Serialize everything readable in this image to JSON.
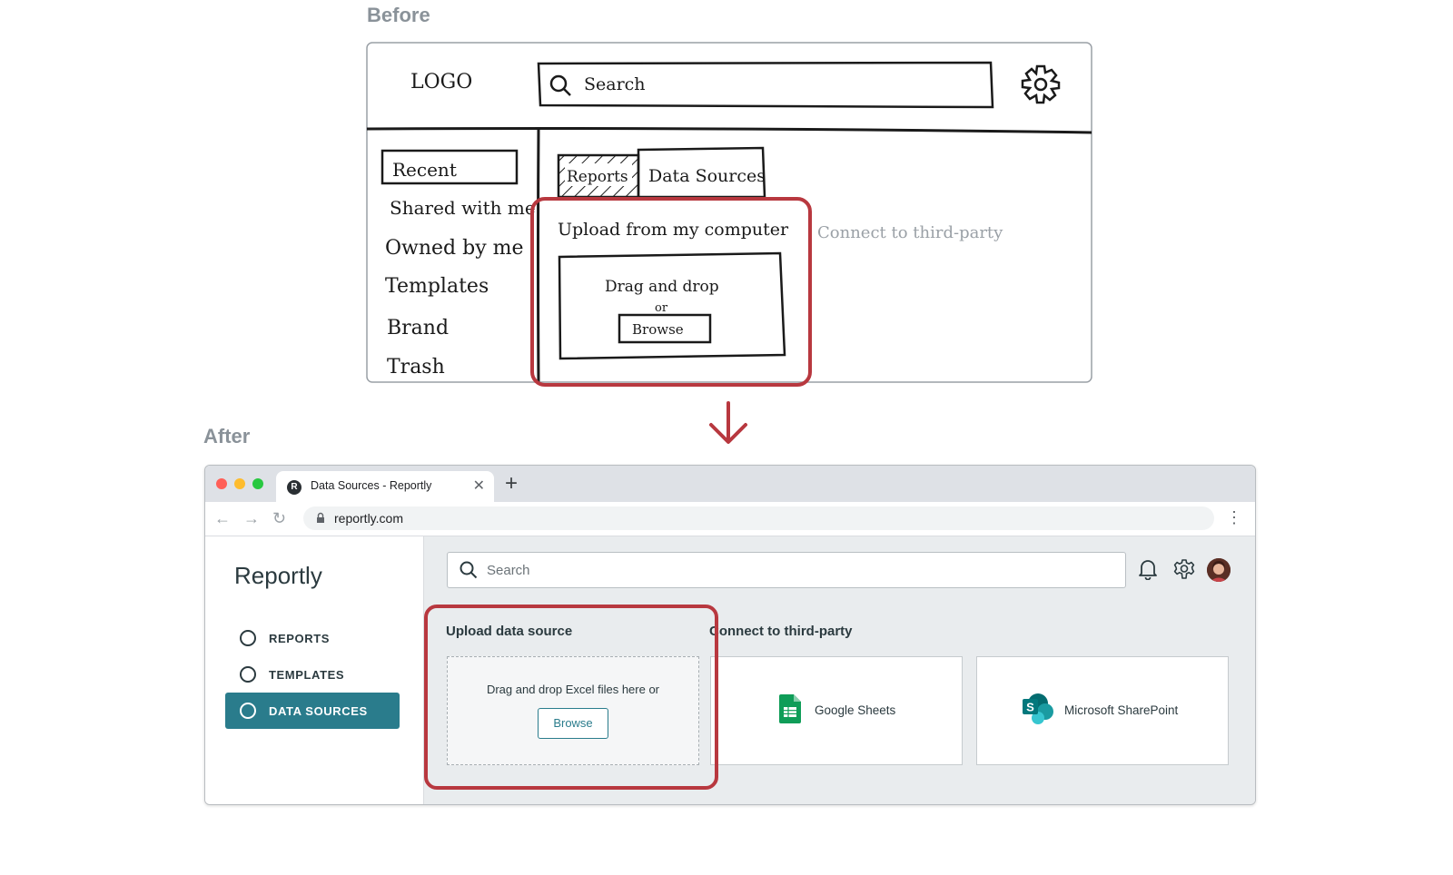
{
  "before": {
    "label": "Before",
    "logo": "LOGO",
    "search": "Search",
    "sidebar": [
      "Recent",
      "Shared with me",
      "Owned by me",
      "Templates",
      "Brand",
      "Trash"
    ],
    "tabs": [
      "Reports",
      "Data Sources"
    ],
    "upload_title": "Upload from my computer",
    "drag_text": "Drag and drop",
    "or_text": "or",
    "browse": "Browse",
    "connect": "Connect to third-party"
  },
  "after": {
    "label": "After",
    "browser": {
      "tab_title": "Data Sources - Reportly",
      "favicon": "R",
      "url": "reportly.com"
    },
    "app": {
      "brand": "Reportly",
      "nav": [
        {
          "label": "REPORTS",
          "active": false
        },
        {
          "label": "TEMPLATES",
          "active": false
        },
        {
          "label": "DATA SOURCES",
          "active": true
        }
      ],
      "search_placeholder": "Search",
      "upload": {
        "title": "Upload data source",
        "drop_text": "Drag and drop Excel files here or",
        "browse": "Browse"
      },
      "connect": {
        "title": "Connect to third-party",
        "cards": [
          "Google Sheets",
          "Microsoft SharePoint"
        ]
      }
    }
  },
  "colors": {
    "accent": "#2a7c8c",
    "highlight": "#b8383f",
    "label": "#8a9299"
  }
}
